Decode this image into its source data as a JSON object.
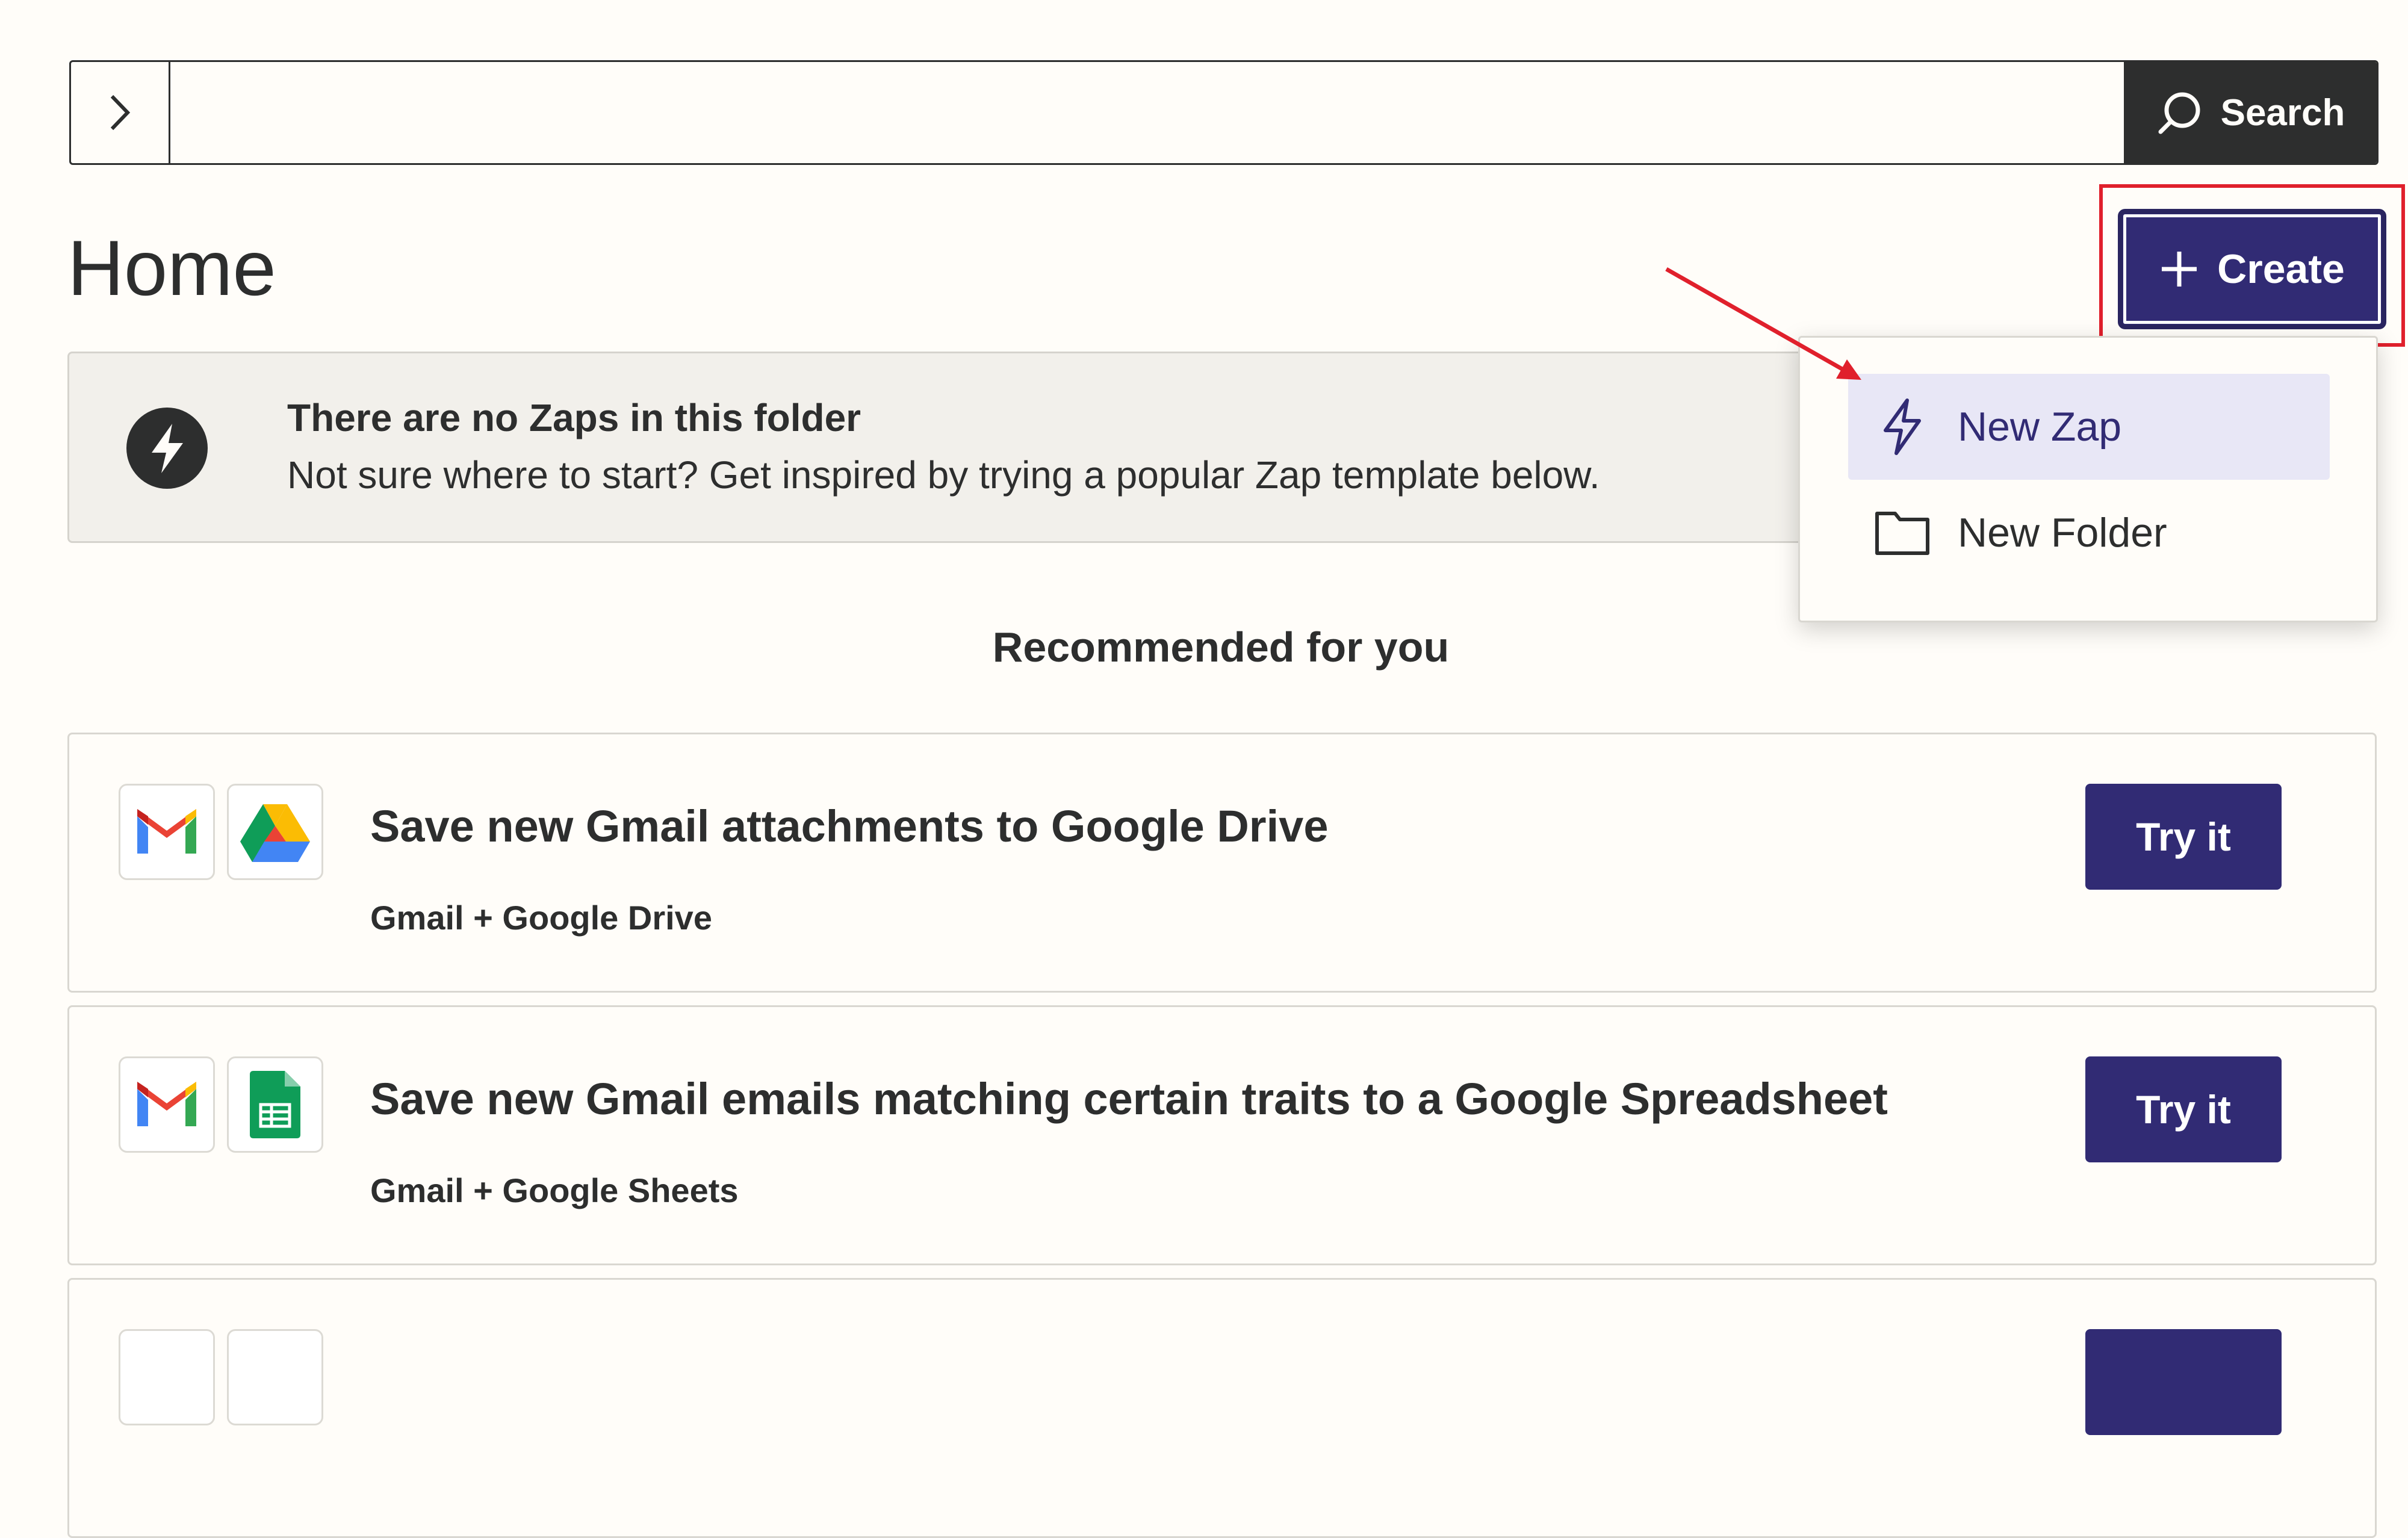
{
  "search": {
    "placeholder": "",
    "button_label": "Search"
  },
  "page": {
    "title": "Home"
  },
  "create_button": {
    "label": "Create"
  },
  "banner": {
    "title": "There are no Zaps in this folder",
    "text": "Not sure where to start? Get inspired by trying a popular Zap template below."
  },
  "create_menu": {
    "items": [
      {
        "label": "New Zap",
        "icon": "lightning-icon",
        "state": "highlighted"
      },
      {
        "label": "New Folder",
        "icon": "folder-icon"
      }
    ]
  },
  "recommended": {
    "heading": "Recommended for you",
    "templates": [
      {
        "title": "Save new Gmail attachments to Google Drive",
        "apps": "Gmail + Google Drive",
        "icons": [
          "gmail-icon",
          "google-drive-icon"
        ],
        "button": "Try it"
      },
      {
        "title": "Save new Gmail emails matching certain traits to a Google Spreadsheet",
        "apps": "Gmail + Google Sheets",
        "icons": [
          "gmail-icon",
          "google-sheets-icon"
        ],
        "button": "Try it"
      }
    ]
  },
  "colors": {
    "background": "#fffdf9",
    "primary": "#312b74",
    "text": "#2d2e2e",
    "highlight": "#e0202c",
    "menu_active": "#e8e7f6"
  }
}
